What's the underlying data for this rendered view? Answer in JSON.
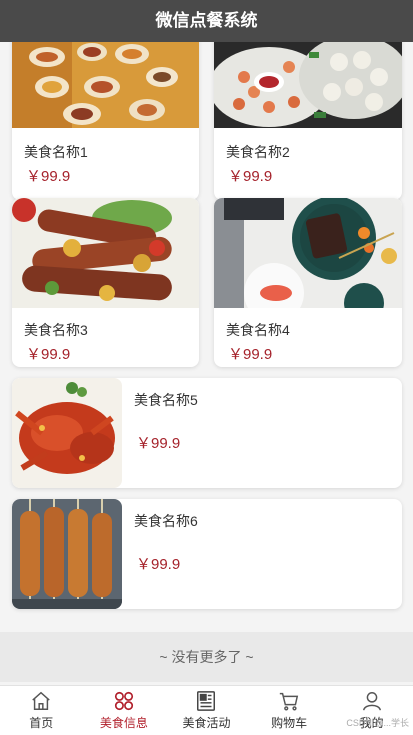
{
  "app": {
    "title": "微信点餐系统"
  },
  "grid_items": [
    {
      "name": "美食名称1",
      "price": "￥99.9",
      "image": "food-platter-photo"
    },
    {
      "name": "美食名称2",
      "price": "￥99.9",
      "image": "shrimp-dumplings-photo"
    },
    {
      "name": "美食名称3",
      "price": "￥99.9",
      "image": "bbq-sausage-photo"
    },
    {
      "name": "美食名称4",
      "price": "￥99.9",
      "image": "steak-plates-photo"
    }
  ],
  "list_items": [
    {
      "name": "美食名称5",
      "price": "￥99.9",
      "image": "crab-photo"
    },
    {
      "name": "美食名称6",
      "price": "￥99.9",
      "image": "skewers-photo"
    }
  ],
  "footer_note": "~ 没有更多了 ~",
  "tabs": [
    {
      "label": "首页",
      "icon": "home-icon",
      "active": false
    },
    {
      "label": "美食信息",
      "icon": "grid-flower-icon",
      "active": true
    },
    {
      "label": "美食活动",
      "icon": "newspaper-icon",
      "active": false
    },
    {
      "label": "购物车",
      "icon": "cart-icon",
      "active": false
    },
    {
      "label": "我的",
      "icon": "user-icon",
      "active": false
    }
  ],
  "watermark": "CSDN @...学长",
  "colors": {
    "header_bg": "#4a4a4a",
    "accent": "#b01e2a",
    "price": "#a5222b"
  }
}
